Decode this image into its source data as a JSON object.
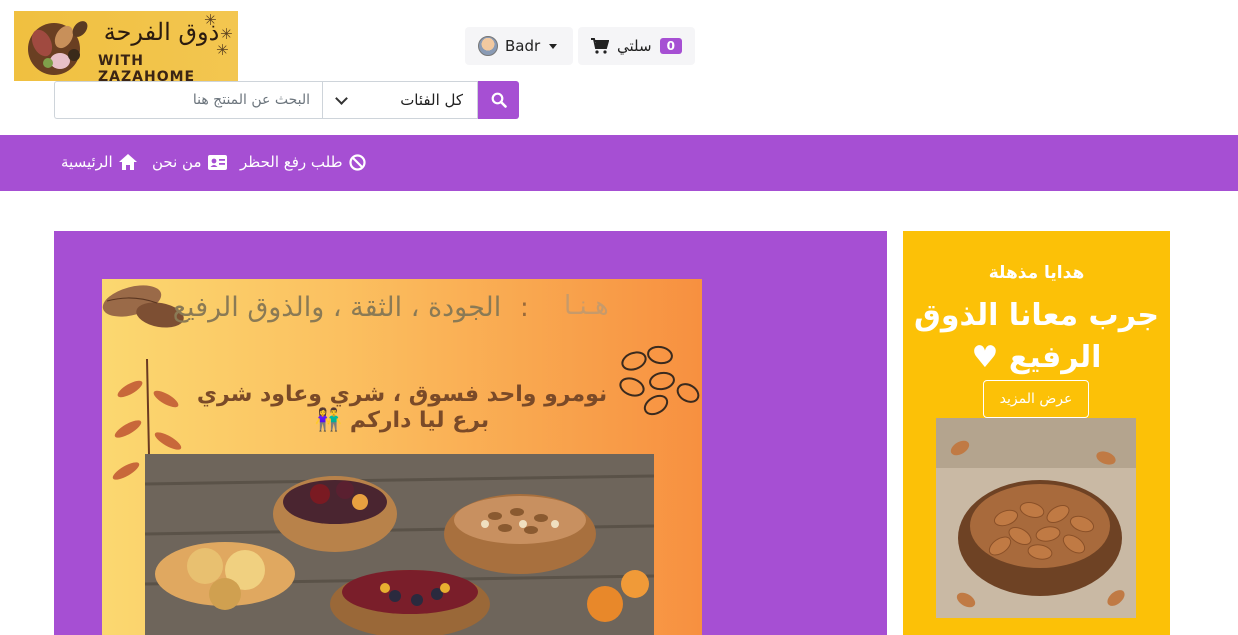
{
  "logo": {
    "arabic_title": "ذوق الفرحة",
    "subtitle": "WITH ZAZAHOME"
  },
  "header": {
    "user_name": "Badr",
    "cart_label": "سلتي",
    "cart_count": "0"
  },
  "search": {
    "placeholder": "البحث عن المنتج هنا",
    "category_selected": "كل الفئات"
  },
  "nav": {
    "items": [
      {
        "label": "الرئيسية",
        "icon": "home-icon"
      },
      {
        "label": "من نحن",
        "icon": "id-card-icon"
      },
      {
        "label": "طلب رفع الحظر",
        "icon": "ban-icon"
      }
    ]
  },
  "banner": {
    "here": "هـنـا",
    "colon": ":",
    "headline": "الجودة ، الثقة ، والذوق الرفيع",
    "subline": "نومرو واحد فسوق ، شري وعاود شري برع ليا داركم 👫"
  },
  "side": {
    "kicker": "هدايا مذهلة",
    "title": "جرب معانا الذوق الرفيع ♥",
    "button_label": "عرض المزيد"
  },
  "colors": {
    "brand_purple": "#a64fd3",
    "side_yellow": "#fcc107"
  }
}
